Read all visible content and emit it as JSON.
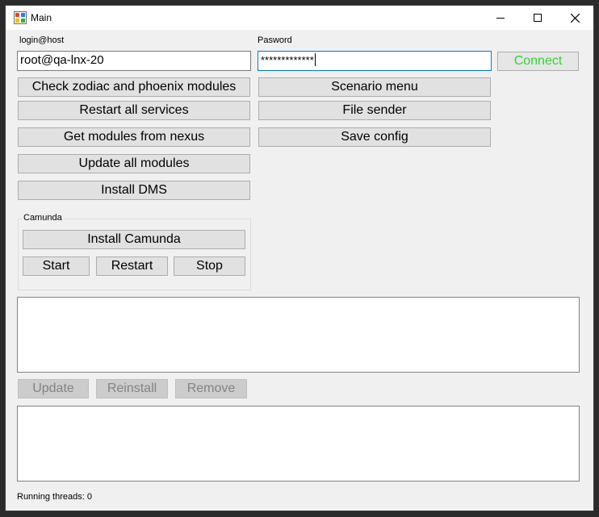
{
  "window": {
    "title": "Main"
  },
  "login": {
    "label": "login@host",
    "value": "root@qa-lnx-20"
  },
  "password": {
    "label": "Pasword",
    "masked_value": "*************"
  },
  "connect": {
    "label": "Connect",
    "text_color": "#2fd62f"
  },
  "left_buttons": [
    "Check zodiac and phoenix modules",
    "Restart all services",
    "Get modules from nexus",
    "Update all modules",
    "Install DMS"
  ],
  "right_buttons": [
    "Scenario menu",
    "File sender",
    "Save config"
  ],
  "camunda": {
    "legend": "Camunda",
    "install_label": "Install Camunda",
    "start_label": "Start",
    "restart_label": "Restart",
    "stop_label": "Stop"
  },
  "module_actions": {
    "update_label": "Update",
    "reinstall_label": "Reinstall",
    "remove_label": "Remove"
  },
  "status": {
    "text": "Running threads: 0"
  }
}
